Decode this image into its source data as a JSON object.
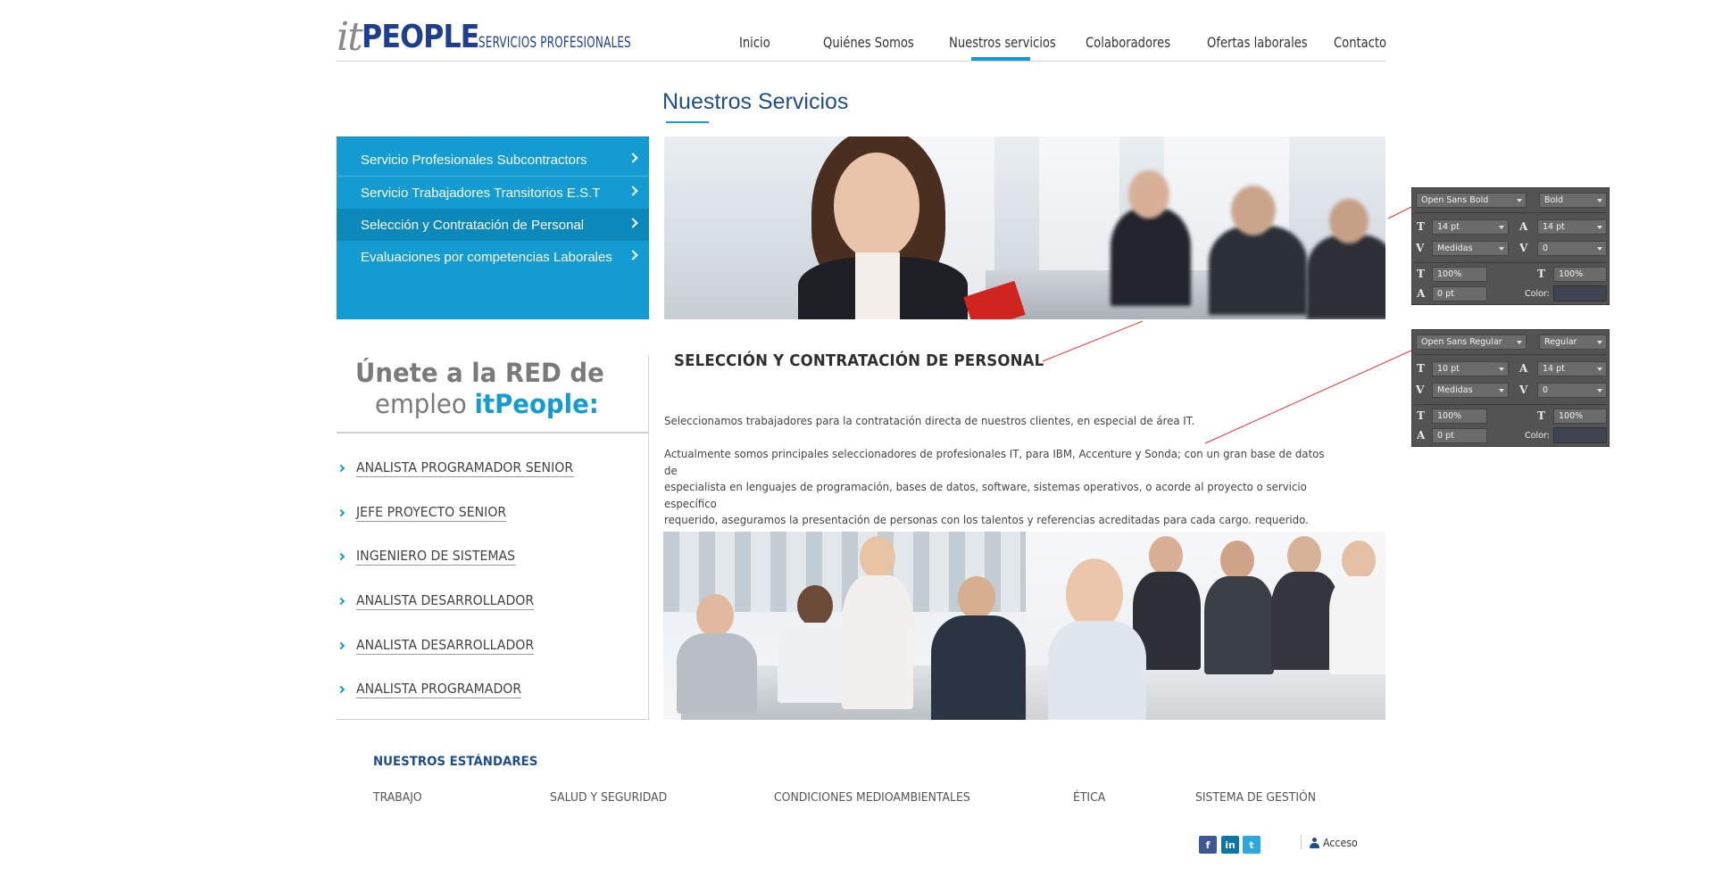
{
  "brand": {
    "logo_it": "it",
    "logo_people": "PEOPLE",
    "tagline": "SERVICIOS PROFESIONALES"
  },
  "nav": {
    "items": [
      {
        "label": "Inicio"
      },
      {
        "label": "Quiénes Somos"
      },
      {
        "label": "Nuestros servicios",
        "active": true
      },
      {
        "label": "Colaboradores"
      },
      {
        "label": "Ofertas laborales"
      },
      {
        "label": "Contacto"
      }
    ],
    "accent_color": "#139bd2"
  },
  "page": {
    "title": "Nuestros Servicios"
  },
  "sidebar": {
    "background": "#139bd2",
    "items": [
      {
        "label": "Servicio Profesionales Subcontractors"
      },
      {
        "label": "Servicio  Trabajadores Transitorios E.S.T"
      },
      {
        "label": "Selección y Contratación de Personal",
        "active": true
      },
      {
        "label": "Evaluaciones por competencias Laborales"
      }
    ]
  },
  "content": {
    "heading": "SELECCIÓN Y CONTRATACIÓN DE PERSONAL",
    "paragraph1": "Seleccionamos trabajadores para la contratación directa de nuestros clientes, en especial de área IT.",
    "paragraph2_line1": "Actualmente somos principales seleccionadores de profesionales IT, para IBM, Accenture y Sonda; con un gran base de datos de",
    "paragraph2_line2": "especialista en lenguajes de programación, bases de datos, software, sistemas operativos, o acorde al proyecto o servicio específico",
    "paragraph2_line3": "requerido, aseguramos la presentación de personas con los talentos y referencias acreditadas para cada cargo. requerido."
  },
  "join": {
    "line1": "Únete a la RED de",
    "line2_prefix": "empleo ",
    "line2_brand": "itPeople:",
    "jobs": [
      {
        "label": "ANALISTA PROGRAMADOR SENIOR"
      },
      {
        "label": "JEFE PROYECTO SENIOR "
      },
      {
        "label": "INGENIERO DE SISTEMAS"
      },
      {
        "label": "ANALISTA DESARROLLADOR"
      },
      {
        "label": "ANALISTA DESARROLLADOR"
      },
      {
        "label": "ANALISTA PROGRAMADOR"
      }
    ]
  },
  "standards": {
    "title": "NUESTROS ESTÁNDARES",
    "items": [
      {
        "label": "TRABAJO"
      },
      {
        "label": "SALUD Y SEGURIDAD"
      },
      {
        "label": "CONDICIONES MEDIOAMBIENTALES"
      },
      {
        "label": "ÉTICA"
      },
      {
        "label": "SISTEMA DE GESTIÓN"
      }
    ]
  },
  "footer": {
    "social": [
      {
        "icon": "facebook-icon",
        "glyph": "f",
        "color": "#3b5998"
      },
      {
        "icon": "linkedin-icon",
        "glyph": "in",
        "color": "#0e76a8"
      },
      {
        "icon": "twitter-icon",
        "glyph": "t",
        "color": "#2aa9e0"
      }
    ],
    "access_label": "Acceso"
  },
  "annotations": {
    "panel_bold": {
      "font": "Open Sans Bold",
      "style": "Bold",
      "size": "14 pt",
      "leading": "14 pt",
      "kerning": "Medidas",
      "tracking": "0",
      "vscale": "100%",
      "hscale": "100%",
      "baseline": "0 pt",
      "color_label": "Color:"
    },
    "panel_regular": {
      "font": "Open Sans Regular",
      "style": "Regular",
      "size": "10 pt",
      "leading": "14 pt",
      "kerning": "Medidas",
      "tracking": "0",
      "vscale": "100%",
      "hscale": "100%",
      "baseline": "0 pt",
      "color_label": "Color:"
    },
    "leader_color": "#e53935"
  }
}
